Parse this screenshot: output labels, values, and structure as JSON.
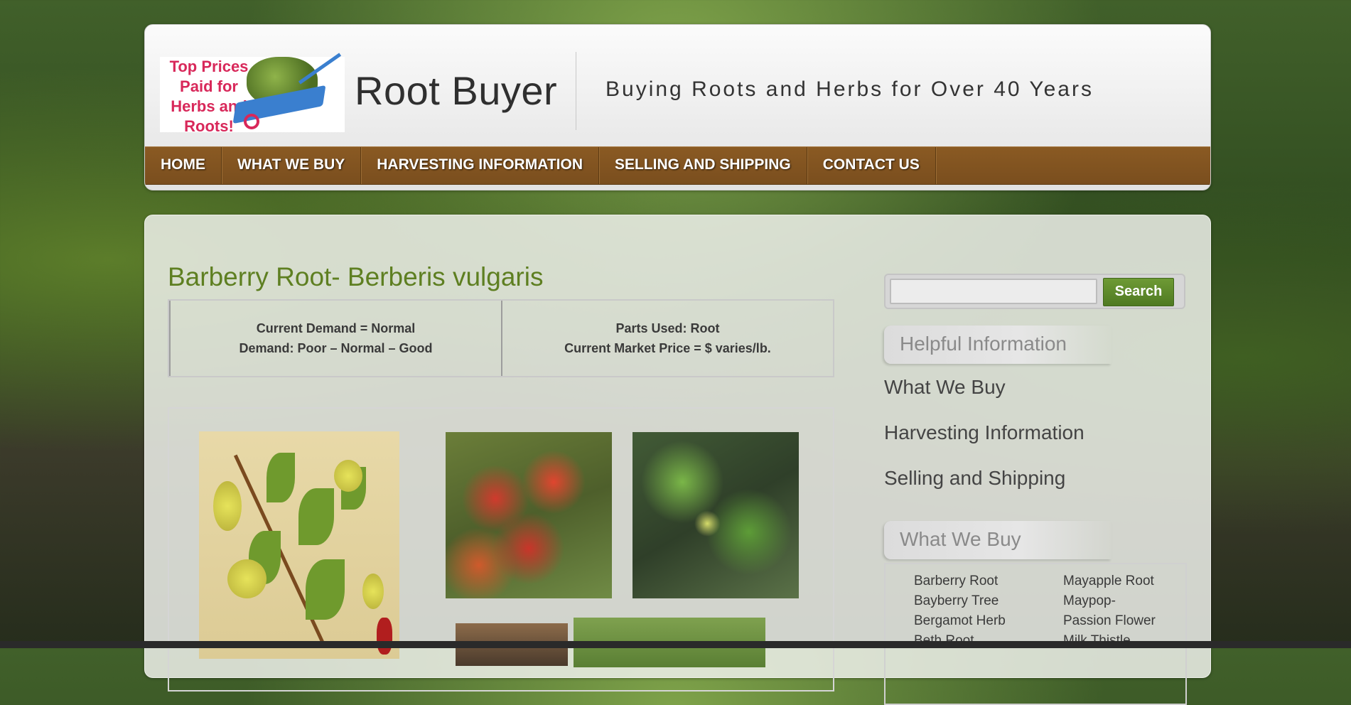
{
  "site": {
    "logo_text": "Top Prices Paid for Herbs and Roots!",
    "title": "Root Buyer",
    "tagline": "Buying Roots and Herbs for Over 40 Years"
  },
  "nav": {
    "items": [
      {
        "label": "HOME"
      },
      {
        "label": "WHAT WE BUY"
      },
      {
        "label": "HARVESTING INFORMATION"
      },
      {
        "label": "SELLING AND SHIPPING"
      },
      {
        "label": "CONTACT US"
      }
    ]
  },
  "post": {
    "title": "Barberry Root- Berberis vulgaris",
    "demand_line1": "Current Demand = Normal",
    "demand_line2": "Demand: Poor – Normal – Good",
    "parts_line1": "Parts Used: Root",
    "parts_line2": "Current Market Price = $ varies/lb."
  },
  "sidebar": {
    "search": {
      "placeholder": "",
      "button_label": "Search"
    },
    "helpful_title": "Helpful Information",
    "helpful_links": [
      "What We Buy",
      "Harvesting Information",
      "Selling and Shipping"
    ],
    "what_we_buy_title": "What We Buy",
    "what_we_buy_col1": [
      "Barberry Root",
      "Bayberry Tree",
      "Bergamot Herb",
      "Beth Root"
    ],
    "what_we_buy_col2": [
      "Mayapple Root",
      "Maypop-",
      "Passion Flower",
      "Milk Thistle"
    ]
  },
  "colors": {
    "nav_bg": "#7a4e1e",
    "title_green": "#5e7f21",
    "search_button": "#4f7a22"
  }
}
